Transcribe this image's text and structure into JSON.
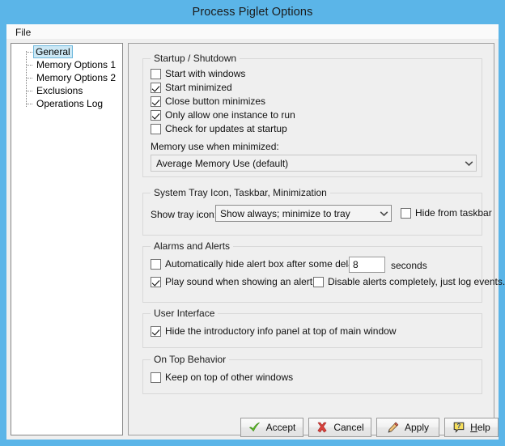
{
  "window": {
    "title": "Process Piglet Options",
    "frame_color": "#5BB5E8",
    "client_bg": "#EFEFEF"
  },
  "menubar": {
    "items": [
      {
        "label": "File",
        "name": "menu-file"
      }
    ]
  },
  "sidebar": {
    "items": [
      {
        "label": "General",
        "selected": true
      },
      {
        "label": "Memory Options 1",
        "selected": false
      },
      {
        "label": "Memory Options 2",
        "selected": false
      },
      {
        "label": "Exclusions",
        "selected": false
      },
      {
        "label": "Operations Log",
        "selected": false
      }
    ],
    "selection_bg": "#CCE8F5",
    "selection_border": "#6EB8DC"
  },
  "groups": {
    "startup": {
      "title": "Startup / Shutdown",
      "checkboxes": [
        {
          "label": "Start with windows",
          "checked": false
        },
        {
          "label": "Start minimized",
          "checked": true
        },
        {
          "label": "Close button minimizes",
          "checked": true
        },
        {
          "label": "Only allow one instance to run",
          "checked": true
        },
        {
          "label": "Check for updates at startup",
          "checked": false
        }
      ],
      "memory_label": "Memory use when minimized:",
      "memory_value": "Average Memory Use (default)"
    },
    "tray": {
      "title": "System Tray Icon, Taskbar, Minimization",
      "tray_label": "Show tray icon:",
      "tray_value": "Show always; minimize to tray",
      "hide_taskbar": {
        "label": "Hide from taskbar",
        "checked": false
      }
    },
    "alarms": {
      "title": "Alarms and Alerts",
      "auto_hide": {
        "label": "Automatically hide alert box after some delay:",
        "checked": false
      },
      "delay_value": "8",
      "seconds_label": "seconds",
      "play_sound": {
        "label": "Play sound when showing an alert",
        "checked": true
      },
      "disable_alerts": {
        "label": "Disable alerts completely, just log events.",
        "checked": false
      }
    },
    "ui": {
      "title": "User Interface",
      "hide_intro": {
        "label": "Hide the introductory info panel at top of main window",
        "checked": true
      }
    },
    "ontop": {
      "title": "On Top Behavior",
      "keep_on_top": {
        "label": "Keep on top of other windows",
        "checked": false
      }
    }
  },
  "buttons": {
    "accept": {
      "label": "Accept",
      "icon": "green-check-icon",
      "color": "#5BBA31"
    },
    "cancel": {
      "label": "Cancel",
      "icon": "red-x-icon",
      "color": "#D9413C"
    },
    "apply": {
      "label": "Apply",
      "icon": "pencil-icon",
      "color": "#E8A33D"
    },
    "help": {
      "label": "Help",
      "accel": "H",
      "rest": "elp",
      "icon": "help-balloon-icon",
      "color": "#F2D23A"
    }
  }
}
